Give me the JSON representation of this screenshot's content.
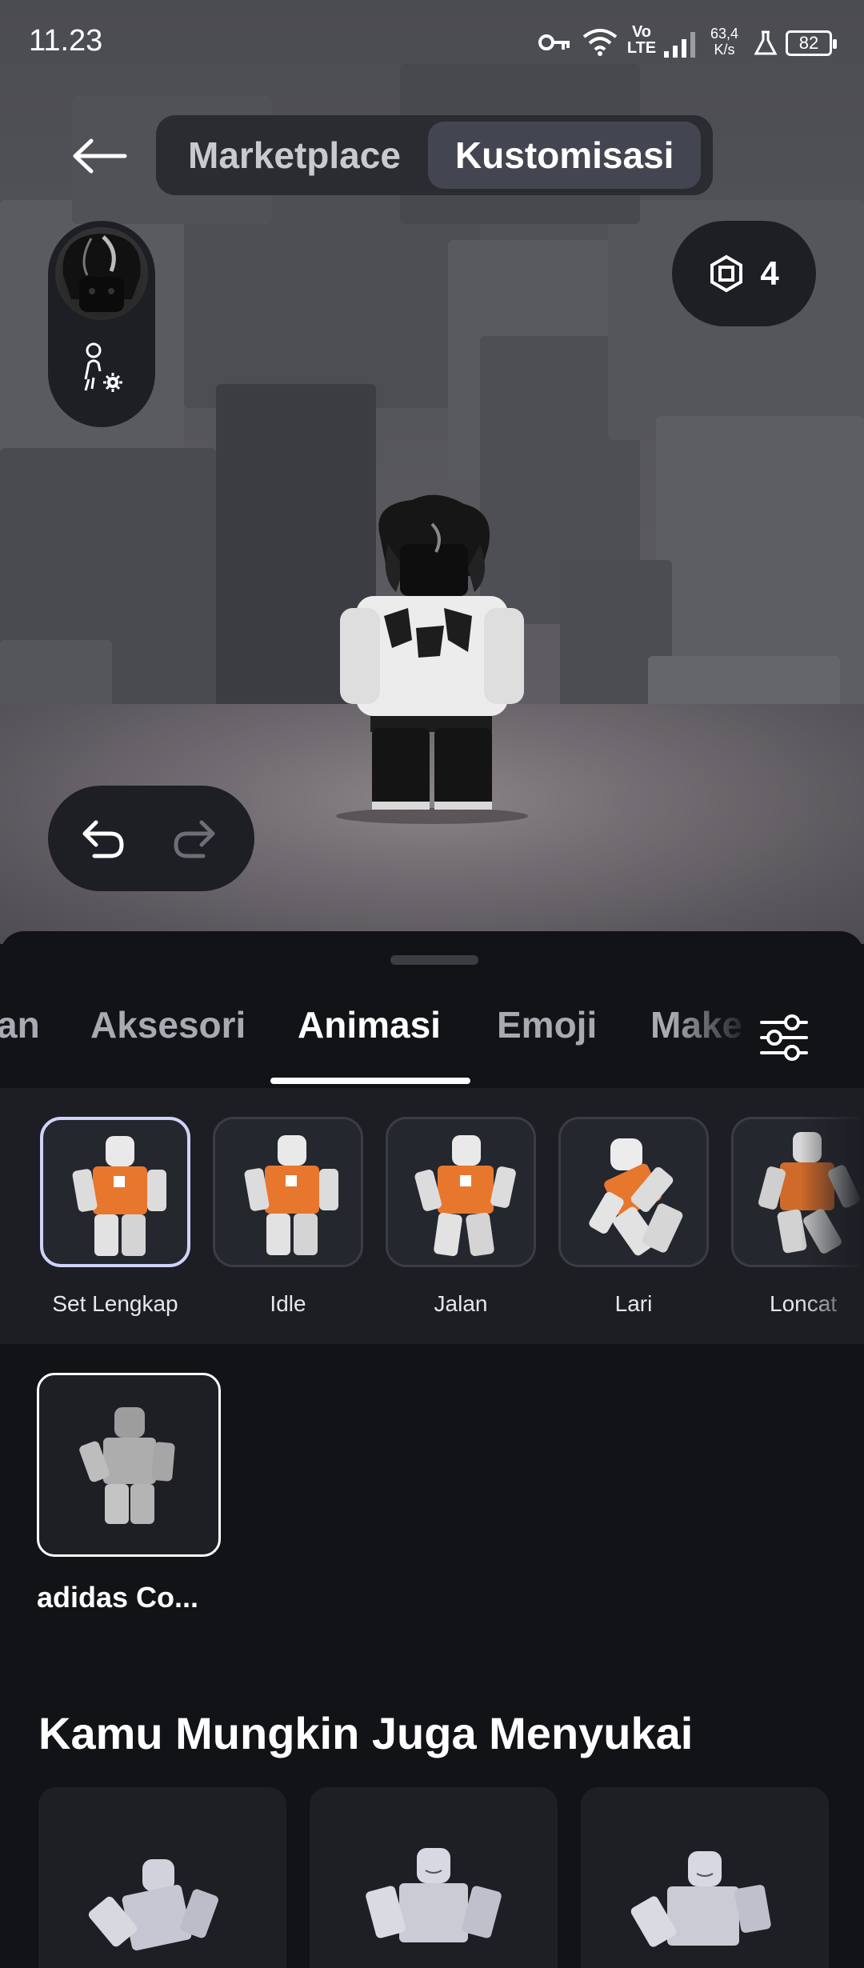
{
  "status_bar": {
    "time": "11.23",
    "network": "Vo LTE",
    "speed_value": "63,4",
    "speed_unit": "K/s",
    "battery": "82"
  },
  "nav": {
    "tabs": [
      {
        "label": "Marketplace",
        "active": false
      },
      {
        "label": "Kustomisasi",
        "active": true
      }
    ]
  },
  "robux": {
    "count": "4"
  },
  "categories": [
    {
      "label": "an",
      "active": false
    },
    {
      "label": "Aksesori",
      "active": false
    },
    {
      "label": "Animasi",
      "active": true
    },
    {
      "label": "Emoji",
      "active": false
    },
    {
      "label": "Make",
      "active": false
    }
  ],
  "animations": [
    {
      "label": "Set Lengkap",
      "selected": true
    },
    {
      "label": "Idle",
      "selected": false
    },
    {
      "label": "Jalan",
      "selected": false
    },
    {
      "label": "Lari",
      "selected": false
    },
    {
      "label": "Loncat",
      "selected": false
    }
  ],
  "owned_items": [
    {
      "name": "adidas Co..."
    }
  ],
  "recommendations": {
    "heading": "Kamu Mungkin Juga Menyukai"
  },
  "colors": {
    "sheet_bg": "#121317",
    "row_bg": "#1c1e24",
    "accent_orange": "#e8772e",
    "selected_border": "#cfd3f8"
  }
}
